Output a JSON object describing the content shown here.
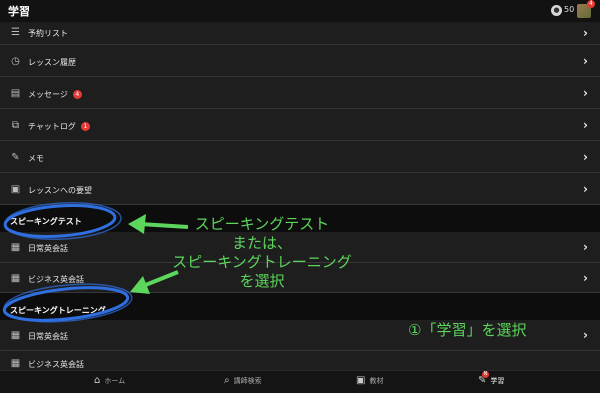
{
  "header": {
    "title": "学習",
    "coin_count": "50",
    "avatar_badge": "4"
  },
  "list_items": [
    {
      "label": "予約リスト",
      "icon": "list-icon"
    },
    {
      "label": "レッスン履歴",
      "icon": "history-icon"
    },
    {
      "label": "メッセージ",
      "icon": "inbox-icon",
      "badge": "4"
    },
    {
      "label": "チャットログ",
      "icon": "chat-icon",
      "badge": "1"
    },
    {
      "label": "メモ",
      "icon": "memo-icon"
    },
    {
      "label": "レッスンへの要望",
      "icon": "clipboard-icon"
    }
  ],
  "sections": [
    {
      "title": "スピーキングテスト",
      "items": [
        {
          "label": "日常英会話"
        },
        {
          "label": "ビジネス英会話"
        }
      ]
    },
    {
      "title": "スピーキングトレーニング",
      "items": [
        {
          "label": "日常英会話"
        },
        {
          "label": "ビジネス英会話"
        }
      ]
    }
  ],
  "annotations": {
    "main_line1": "スピーキングテスト",
    "main_line2": "または、",
    "main_line3": "スピーキングトレーニング",
    "main_line4": "を選択",
    "step": "①「学習」を選択"
  },
  "tabbar": [
    {
      "label": "ホーム",
      "icon": "home-icon"
    },
    {
      "label": "講師検索",
      "icon": "search-icon"
    },
    {
      "label": "教材",
      "icon": "book-icon"
    },
    {
      "label": "学習",
      "icon": "pen-icon",
      "badge": "N"
    }
  ],
  "colors": {
    "annotation_green": "#5cd65c",
    "annotation_blue": "#2f6fe0",
    "badge_red": "#e53935"
  }
}
